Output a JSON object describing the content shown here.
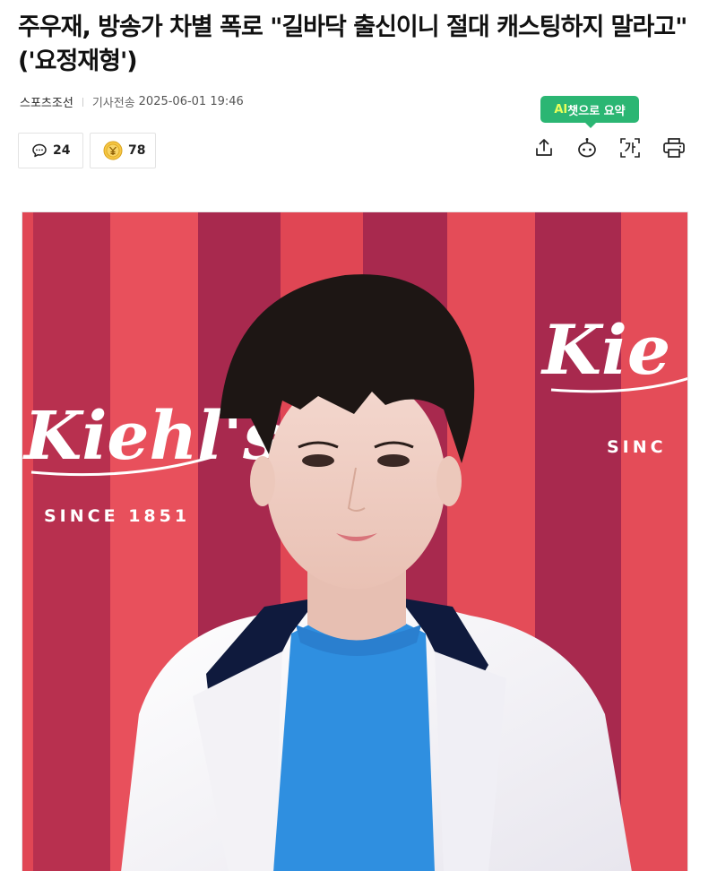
{
  "article": {
    "headline": "주우재, 방송가 차별 폭로 \"길바닥 출신이니 절대 캐스팅하지 말라고\" ('요정재형')",
    "press": "스포츠조선",
    "timestamp_label": "기사전송",
    "timestamp": "2025-06-01 19:46"
  },
  "counters": {
    "comments": "24",
    "reactions": "78"
  },
  "toolbar": {
    "ai_summary_prefix": "AI",
    "ai_summary_label": "챗으로 요약",
    "icons": [
      "share-icon",
      "ai-bot-icon",
      "font-size-icon",
      "print-icon"
    ]
  },
  "photo": {
    "backdrop_brand": "Kiehl's",
    "backdrop_tagline": "SINCE 1851",
    "backdrop_brand_right": "Kie",
    "backdrop_tagline_right": "SINC"
  },
  "colors": {
    "ai_badge": "#2bb673",
    "stripe_red": "#e04654",
    "stripe_magenta": "#a8294e",
    "sweater_blue": "#2f8fe0"
  }
}
